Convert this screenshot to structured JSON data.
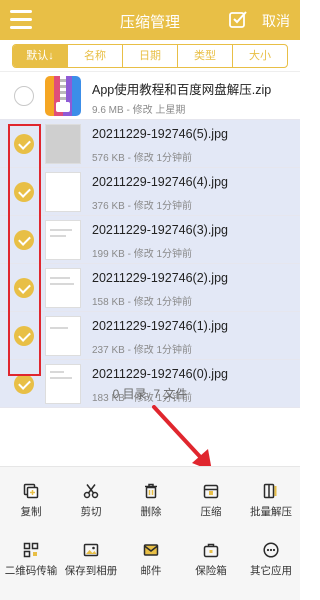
{
  "header": {
    "title": "压缩管理",
    "cancel_label": "取消"
  },
  "sort_tabs": [
    "默认↓",
    "名称",
    "日期",
    "类型",
    "大小"
  ],
  "files": [
    {
      "name": "App使用教程和百度网盘解压.zip",
      "meta": "9.6 MB - 修改 上星期",
      "selected": false
    },
    {
      "name": "20211229-192746(5).jpg",
      "meta": "576 KB - 修改 1分钟前",
      "selected": true
    },
    {
      "name": "20211229-192746(4).jpg",
      "meta": "376 KB - 修改 1分钟前",
      "selected": true
    },
    {
      "name": "20211229-192746(3).jpg",
      "meta": "199 KB - 修改 1分钟前",
      "selected": true
    },
    {
      "name": "20211229-192746(2).jpg",
      "meta": "158 KB - 修改 1分钟前",
      "selected": true
    },
    {
      "name": "20211229-192746(1).jpg",
      "meta": "237 KB - 修改 1分钟前",
      "selected": true
    },
    {
      "name": "20211229-192746(0).jpg",
      "meta": "183 KB - 修改 1分钟前",
      "selected": true
    }
  ],
  "summary": "0 目录, 7 文件",
  "toolbar": {
    "copy": "复制",
    "cut": "剪切",
    "delete": "删除",
    "compress": "压缩",
    "batch_extract": "批量解压",
    "qr_transfer": "二维码传输",
    "save_album": "保存到相册",
    "mail": "邮件",
    "safe": "保险箱",
    "other_apps": "其它应用"
  },
  "colors": {
    "accent": "#e8bf46",
    "selected_row": "#e3e8f6",
    "annotation": "#e0262e"
  }
}
